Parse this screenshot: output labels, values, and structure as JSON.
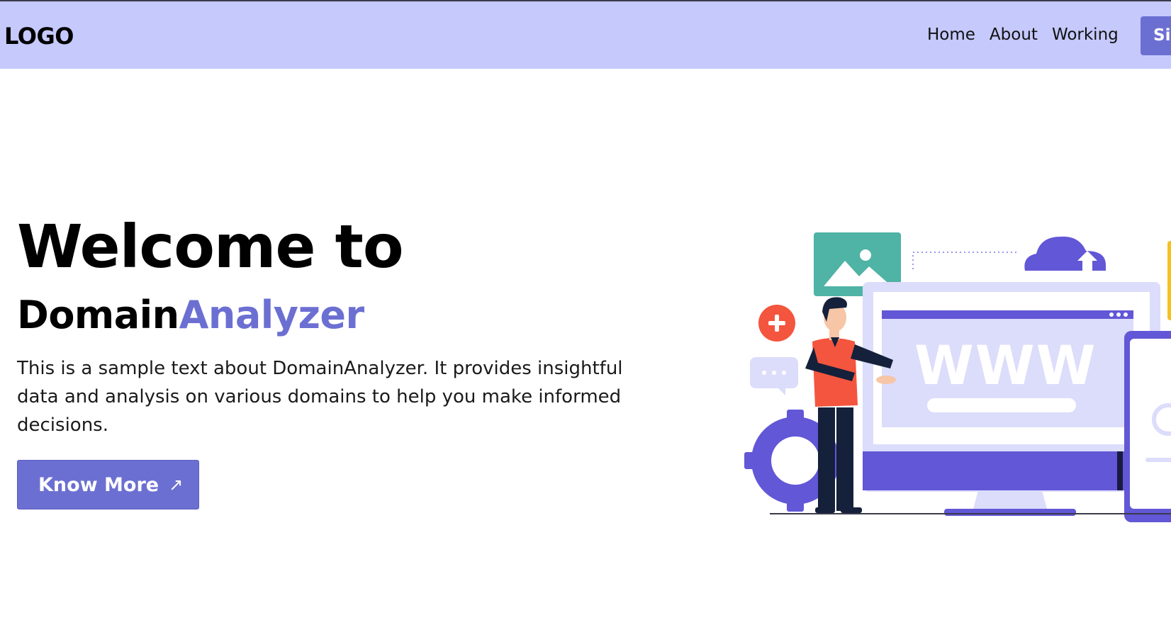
{
  "navbar": {
    "logo": "LOGO",
    "links": [
      "Home",
      "About",
      "Working"
    ],
    "signin_label": "Si"
  },
  "hero": {
    "title": "Welcome to",
    "brand_dark": "Domain",
    "brand_accent": "Analyzer",
    "description": "This is a sample text about DomainAnalyzer. It provides insightful data and analysis on various domains to help you make informed decisions.",
    "button_label": "Know More",
    "button_icon": "arrow-up-right-icon"
  },
  "illustration": {
    "www_text": "WWW"
  },
  "colors": {
    "navbar_bg": "#c5c9fc",
    "accent": "#6c6fd2",
    "illustration_purple": "#6257d6",
    "illustration_light": "#dcdcfb",
    "teal": "#4fb3a5",
    "orange": "#f4553e"
  }
}
